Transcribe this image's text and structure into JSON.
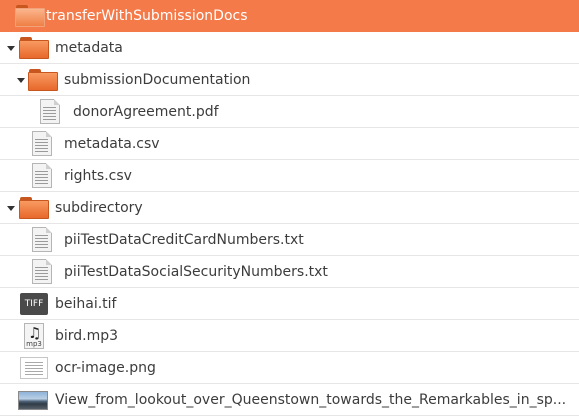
{
  "tree": [
    {
      "label": "transferWithSubmissionDocs",
      "icon": "folder-icon",
      "selected": true
    },
    {
      "label": "metadata",
      "icon": "folder-icon",
      "expanded": true
    },
    {
      "label": "submissionDocumentation",
      "icon": "folder-icon",
      "expanded": true
    },
    {
      "label": "donorAgreement.pdf",
      "icon": "document-icon"
    },
    {
      "label": "metadata.csv",
      "icon": "document-icon"
    },
    {
      "label": "rights.csv",
      "icon": "document-icon"
    },
    {
      "label": "subdirectory",
      "icon": "folder-icon",
      "expanded": true
    },
    {
      "label": "piiTestDataCreditCardNumbers.txt",
      "icon": "document-icon"
    },
    {
      "label": "piiTestDataSocialSecurityNumbers.txt",
      "icon": "document-icon"
    },
    {
      "label": "beihai.tif",
      "icon": "tiff-icon",
      "icon_text": "TIFF"
    },
    {
      "label": "bird.mp3",
      "icon": "audio-file-icon",
      "icon_text": "mp3"
    },
    {
      "label": "ocr-image.png",
      "icon": "image-thumbnail-icon"
    },
    {
      "label": "View_from_lookout_over_Queenstown_towards_the_Remarkables_in_sp...",
      "icon": "photo-thumbnail-icon"
    }
  ],
  "colors": {
    "selected_row": "#f47a4a",
    "folder": "#e8672b",
    "row_divider": "#e6e6e6"
  }
}
